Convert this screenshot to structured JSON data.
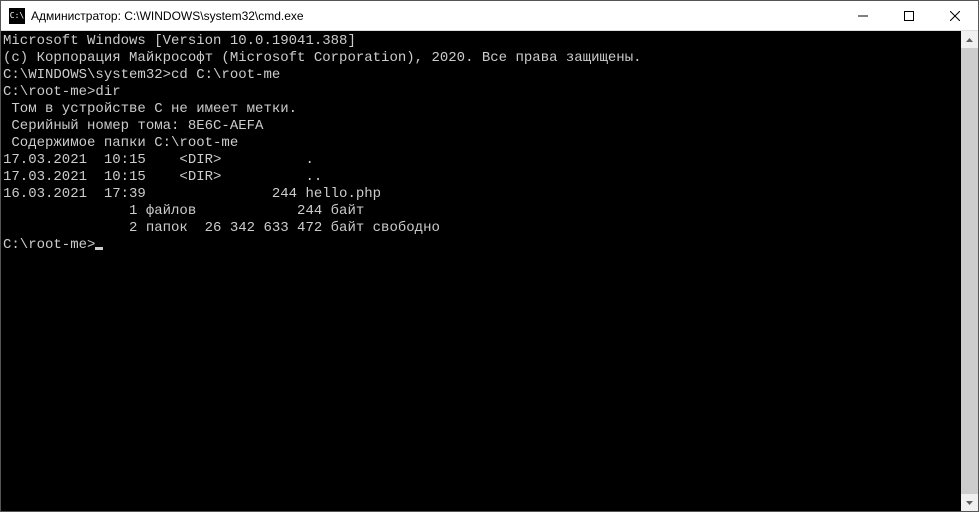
{
  "titlebar": {
    "icon_text": "C:\\",
    "title": "Администратор: C:\\WINDOWS\\system32\\cmd.exe"
  },
  "terminal": {
    "lines": {
      "l0": "Microsoft Windows [Version 10.0.19041.388]",
      "l1": "(c) Корпорация Майкрософт (Microsoft Corporation), 2020. Все права защищены.",
      "l2": "",
      "l3": "C:\\WINDOWS\\system32>cd C:\\root-me",
      "l4": "",
      "l5": "C:\\root-me>dir",
      "l6": " Том в устройстве C не имеет метки.",
      "l7": " Серийный номер тома: 8E6C-AEFA",
      "l8": "",
      "l9": " Содержимое папки C:\\root-me",
      "l10": "",
      "l11": "17.03.2021  10:15    <DIR>          .",
      "l12": "17.03.2021  10:15    <DIR>          ..",
      "l13": "16.03.2021  17:39               244 hello.php",
      "l14": "               1 файлов            244 байт",
      "l15": "               2 папок  26 342 633 472 байт свободно",
      "l16": "",
      "l17": "C:\\root-me>"
    }
  }
}
